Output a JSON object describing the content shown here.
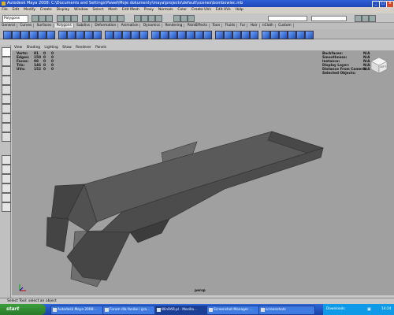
{
  "window": {
    "title": "Autodesk Maya 2008: C:\\Documents and Settings\\Paweł\\Moje dokumenty\\maya\\projects\\default\\scenes\\bombowiec.mb"
  },
  "menus": [
    "File",
    "Edit",
    "Modify",
    "Create",
    "Display",
    "Window",
    "Select",
    "Mesh",
    "Edit Mesh",
    "Proxy",
    "Normals",
    "Color",
    "Create UVs",
    "Edit UVs",
    "Help"
  ],
  "status_line": {
    "mode": "Polygons"
  },
  "shelf_tabs": [
    "General",
    "Curves",
    "Surfaces",
    "Polygons",
    "Subdivs",
    "Deformation",
    "Animation",
    "Dynamics",
    "Rendering",
    "PaintEffects",
    "Toon",
    "Fluids",
    "Fur",
    "Hair",
    "nCloth",
    "Custom"
  ],
  "panel_menu": [
    "View",
    "Shading",
    "Lighting",
    "Show",
    "Renderer",
    "Panels"
  ],
  "hud_left": {
    "labels": [
      "Verts:",
      "Edges:",
      "Faces:",
      "Tris:",
      "UVs:"
    ],
    "values": [
      [
        "81",
        "0",
        "0"
      ],
      [
        "150",
        "0",
        "0"
      ],
      [
        "98",
        "0",
        "0"
      ],
      [
        "146",
        "0",
        "0"
      ],
      [
        "152",
        "0",
        "0"
      ]
    ]
  },
  "hud_right": {
    "labels": [
      "Backfaces:",
      "Smoothness:",
      "Instance:",
      "Display Layer:",
      "Distance From Camera:",
      "Selected Objects:"
    ],
    "values": [
      "N/A",
      "N/A",
      "N/A",
      "N/A",
      "N/A",
      ""
    ]
  },
  "view_cube": {
    "label": "LEFT"
  },
  "viewport": {
    "camera": "persp",
    "bg_color": "#a0a0a0"
  },
  "help_line": "Select Tool: select an object",
  "taskbar": {
    "start": "start",
    "items": [
      "Autodesk Maya 2008:...",
      "Forum dla fanów i gra...",
      "WinRAR.pl - Mozilla...",
      "Screenshot Manager ...",
      "screenshots"
    ],
    "tray": "Downloads",
    "clock": "14:24"
  }
}
